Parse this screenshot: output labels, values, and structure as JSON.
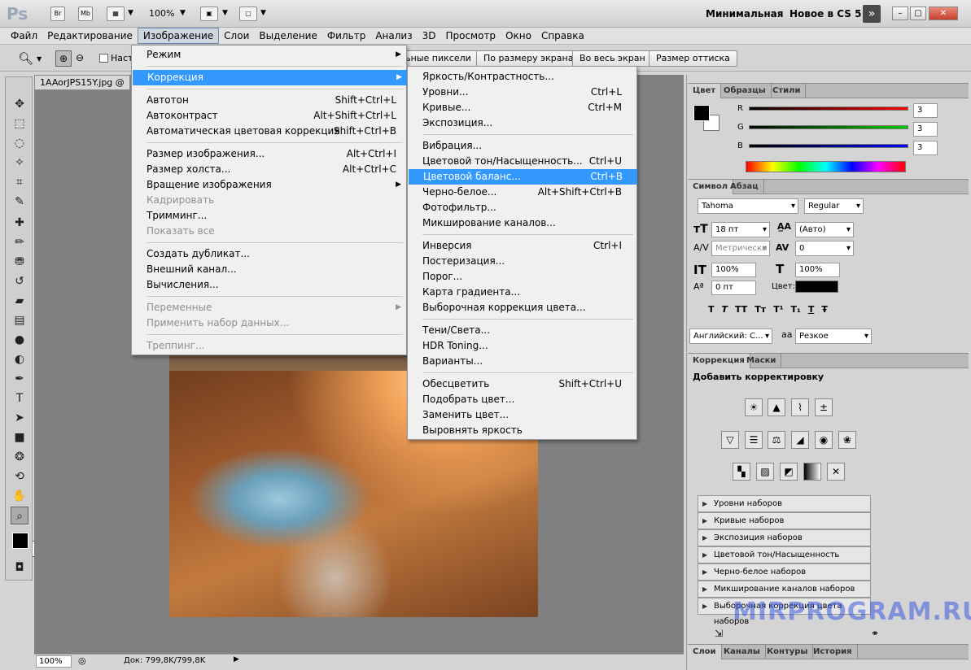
{
  "app": {
    "logo": "Ps",
    "launch_bridge": "Br",
    "launch_mini_bridge": "Mb",
    "zoom": "100%",
    "workspace_minimal": "Минимальная",
    "workspace_new": "Новое в CS 5"
  },
  "menubar": [
    "Файл",
    "Редактирование",
    "Изображение",
    "Слои",
    "Выделение",
    "Фильтр",
    "Анализ",
    "3D",
    "Просмотр",
    "Окно",
    "Справка"
  ],
  "options": {
    "scroll_all_label": "Наст",
    "buttons": [
      "Реальные пиксели",
      "По размеру экрана",
      "Во весь экран",
      "Размер оттиска"
    ]
  },
  "document": {
    "tab_title": "1AAorJPS15Y.jpg @",
    "status_zoom": "100%",
    "status_doc": "Док: 799,8K/799,8K"
  },
  "image_menu": [
    {
      "label": "Режим",
      "arrow": true
    },
    {
      "sep": true
    },
    {
      "label": "Коррекция",
      "arrow": true,
      "highlight": true
    },
    {
      "sep": true
    },
    {
      "label": "Автотон",
      "shortcut": "Shift+Ctrl+L"
    },
    {
      "label": "Автоконтраст",
      "shortcut": "Alt+Shift+Ctrl+L"
    },
    {
      "label": "Автоматическая цветовая коррекция",
      "shortcut": "Shift+Ctrl+B"
    },
    {
      "sep": true
    },
    {
      "label": "Размер изображения...",
      "shortcut": "Alt+Ctrl+I"
    },
    {
      "label": "Размер холста...",
      "shortcut": "Alt+Ctrl+C"
    },
    {
      "label": "Вращение изображения",
      "arrow": true
    },
    {
      "label": "Кадрировать",
      "disabled": true
    },
    {
      "label": "Тримминг..."
    },
    {
      "label": "Показать все",
      "disabled": true
    },
    {
      "sep": true
    },
    {
      "label": "Создать дубликат..."
    },
    {
      "label": "Внешний канал..."
    },
    {
      "label": "Вычисления..."
    },
    {
      "sep": true
    },
    {
      "label": "Переменные",
      "arrow": true,
      "disabled": true
    },
    {
      "label": "Применить набор данных...",
      "disabled": true
    },
    {
      "sep": true
    },
    {
      "label": "Треппинг...",
      "disabled": true
    }
  ],
  "adjust_menu": [
    {
      "label": "Яркость/Контрастность..."
    },
    {
      "label": "Уровни...",
      "shortcut": "Ctrl+L"
    },
    {
      "label": "Кривые...",
      "shortcut": "Ctrl+M"
    },
    {
      "label": "Экспозиция..."
    },
    {
      "sep": true
    },
    {
      "label": "Вибрация..."
    },
    {
      "label": "Цветовой тон/Насыщенность...",
      "shortcut": "Ctrl+U"
    },
    {
      "label": "Цветовой баланс...",
      "shortcut": "Ctrl+B",
      "highlight": true
    },
    {
      "label": "Черно-белое...",
      "shortcut": "Alt+Shift+Ctrl+B"
    },
    {
      "label": "Фотофильтр..."
    },
    {
      "label": "Микширование каналов..."
    },
    {
      "sep": true
    },
    {
      "label": "Инверсия",
      "shortcut": "Ctrl+I"
    },
    {
      "label": "Постеризация..."
    },
    {
      "label": "Порог..."
    },
    {
      "label": "Карта градиента..."
    },
    {
      "label": "Выборочная коррекция цвета..."
    },
    {
      "sep": true
    },
    {
      "label": "Тени/Света..."
    },
    {
      "label": "HDR Toning..."
    },
    {
      "label": "Варианты..."
    },
    {
      "sep": true
    },
    {
      "label": "Обесцветить",
      "shortcut": "Shift+Ctrl+U"
    },
    {
      "label": "Подобрать цвет..."
    },
    {
      "label": "Заменить цвет..."
    },
    {
      "label": "Выровнять яркость"
    }
  ],
  "color_panel": {
    "tabs": [
      "Цвет",
      "Образцы",
      "Стили"
    ],
    "channels": [
      {
        "label": "R",
        "value": "3",
        "color": "#ff0000"
      },
      {
        "label": "G",
        "value": "3",
        "color": "#00cc00"
      },
      {
        "label": "B",
        "value": "3",
        "color": "#0000ff"
      }
    ]
  },
  "char_panel": {
    "tabs": [
      "Символ",
      "Абзац"
    ],
    "font_family": "Tahoma",
    "font_style": "Regular",
    "size": "18 пт",
    "leading": "(Авто)",
    "kerning": "Метрически",
    "tracking": "0",
    "vscale": "100%",
    "hscale": "100%",
    "baseline": "0 пт",
    "color_label": "Цвет:",
    "styles": [
      "T",
      "T",
      "TT",
      "Tт",
      "T¹",
      "T₁",
      "T",
      "Ŧ"
    ],
    "language": "Английский: С...",
    "aa_label": "aa",
    "antialias": "Резкое"
  },
  "adjust_panel": {
    "tabs": [
      "Коррекция",
      "Маски"
    ],
    "heading": "Добавить корректировку",
    "icons": [
      "brightness-icon",
      "levels-icon",
      "curves-icon",
      "exposure-icon",
      "vibrance-icon",
      "hue-sat-icon",
      "color-balance-icon",
      "bw-icon",
      "photo-filter-icon",
      "mixer-icon",
      "invert-icon",
      "posterize-icon",
      "threshold-icon",
      "gradient-map-icon",
      "selective-color-icon"
    ],
    "presets": [
      "Уровни наборов",
      "Кривые наборов",
      "Экспозиция наборов",
      "Цветовой тон/Насыщенность наборов",
      "Черно-белое наборов",
      "Микширование каналов наборов",
      "Выборочная коррекция цвета наборов"
    ]
  },
  "bottom_tabs": [
    "Слои",
    "Каналы",
    "Контуры",
    "История"
  ],
  "watermark": "MIRPROGRAM.RU"
}
